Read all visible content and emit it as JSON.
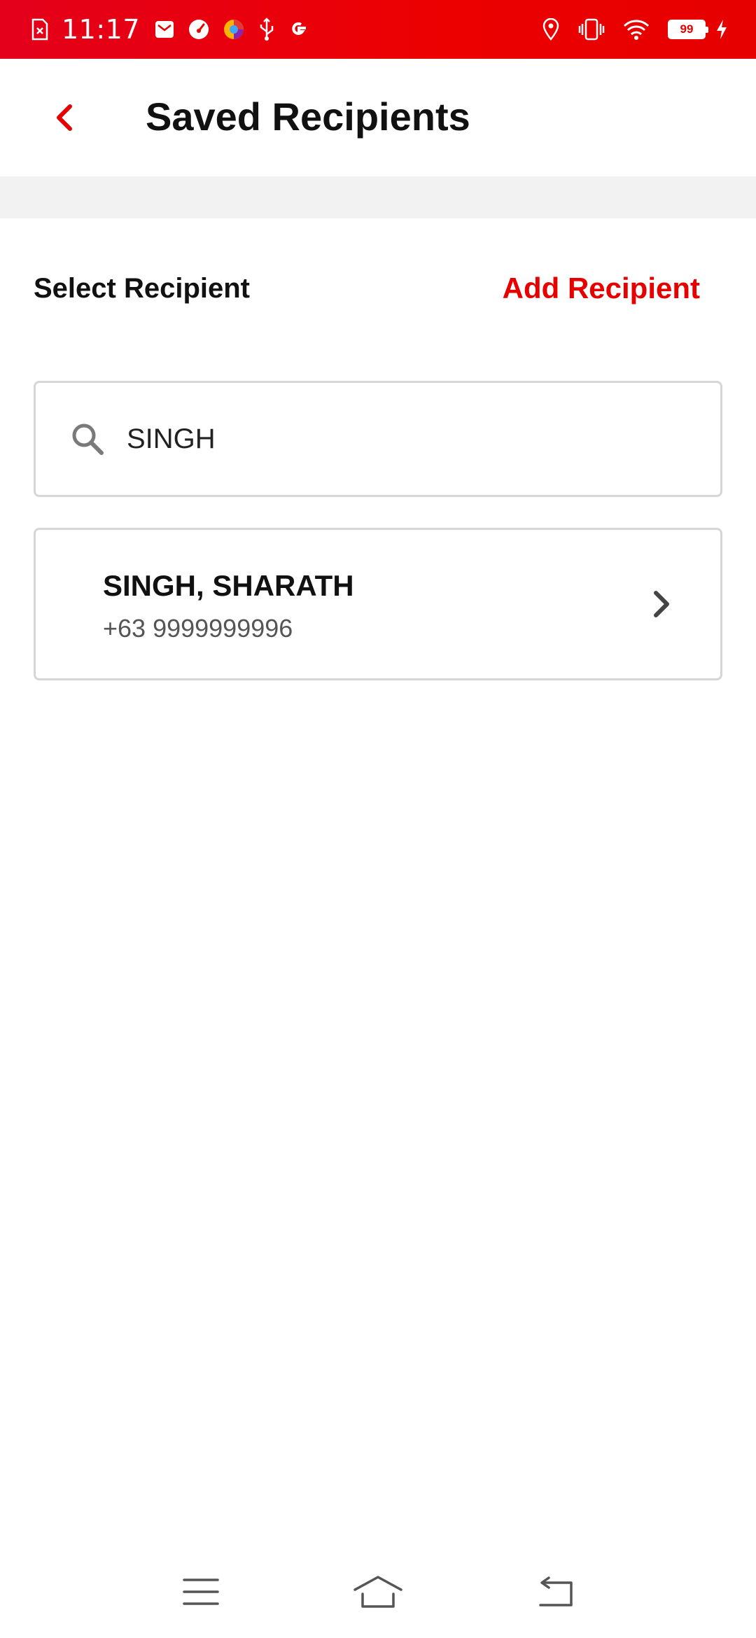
{
  "status_bar": {
    "time": "11:17",
    "battery_level": "99",
    "left_icons": [
      "sim-error-icon",
      "mail-icon",
      "speedometer-icon",
      "browser-icon",
      "usb-icon",
      "google-icon"
    ],
    "right_icons": [
      "location-icon",
      "vibrate-icon",
      "wifi-icon",
      "battery-icon",
      "charging-icon"
    ],
    "background_color": "#e60000"
  },
  "header": {
    "title": "Saved Recipients",
    "back_icon": "chevron-left-icon",
    "accent_color": "#e60000"
  },
  "section": {
    "label": "Select Recipient",
    "add_label": "Add Recipient"
  },
  "search": {
    "value": "SINGH",
    "icon": "search-icon"
  },
  "recipients": [
    {
      "name": "SINGH, SHARATH",
      "phone": "+63 9999999996"
    }
  ],
  "nav_bar": {
    "buttons": [
      "menu-icon",
      "home-icon",
      "back-icon"
    ]
  }
}
